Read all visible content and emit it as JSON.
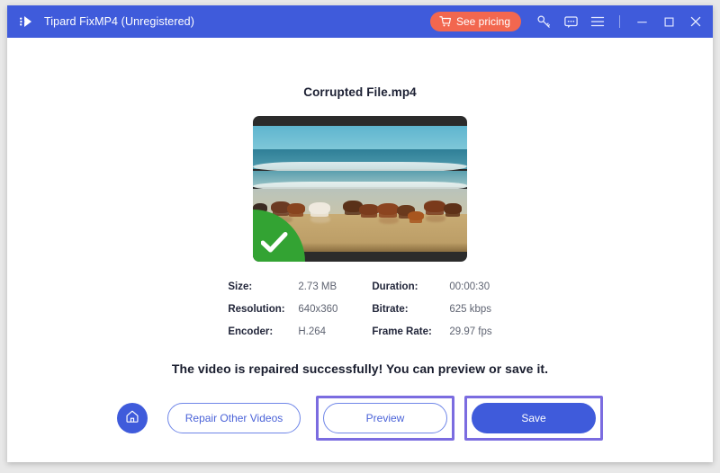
{
  "window": {
    "titlebar": {
      "logo_icon": "tipard-play-logo-icon",
      "app_title": "Tipard FixMP4 (Unregistered)",
      "pricing_button": {
        "label": "See pricing",
        "icon": "shopping-cart-icon",
        "color": "#f2674f"
      },
      "icons": [
        {
          "name": "register-key-icon",
          "glyph": "key"
        },
        {
          "name": "feedback-icon",
          "glyph": "speech-bubble"
        },
        {
          "name": "menu-icon",
          "glyph": "hamburger"
        }
      ],
      "window_controls": [
        {
          "name": "minimize-button",
          "glyph": "minimize"
        },
        {
          "name": "maximize-button",
          "glyph": "maximize"
        },
        {
          "name": "close-button",
          "glyph": "close"
        }
      ],
      "background_color": "#3f5bdb"
    },
    "main": {
      "file_title": "Corrupted File.mp4",
      "thumbnail": {
        "alt": "Horses running on a beach",
        "badge_icon": "success-check-icon",
        "badge_color": "#33a333"
      },
      "metadata": [
        {
          "key": "Size:",
          "value": "2.73 MB"
        },
        {
          "key": "Duration:",
          "value": "00:00:30"
        },
        {
          "key": "Resolution:",
          "value": "640x360"
        },
        {
          "key": "Bitrate:",
          "value": "625 kbps"
        },
        {
          "key": "Encoder:",
          "value": "H.264"
        },
        {
          "key": "Frame Rate:",
          "value": "29.97 fps"
        }
      ],
      "success_message": "The video is repaired successfully! You can preview or save it.",
      "actions": {
        "home_icon": "home-icon",
        "repair_other_label": "Repair Other Videos",
        "preview_label": "Preview",
        "save_label": "Save",
        "highlight_color": "#7b6ce0",
        "accent_color": "#3f5bdb"
      }
    }
  }
}
